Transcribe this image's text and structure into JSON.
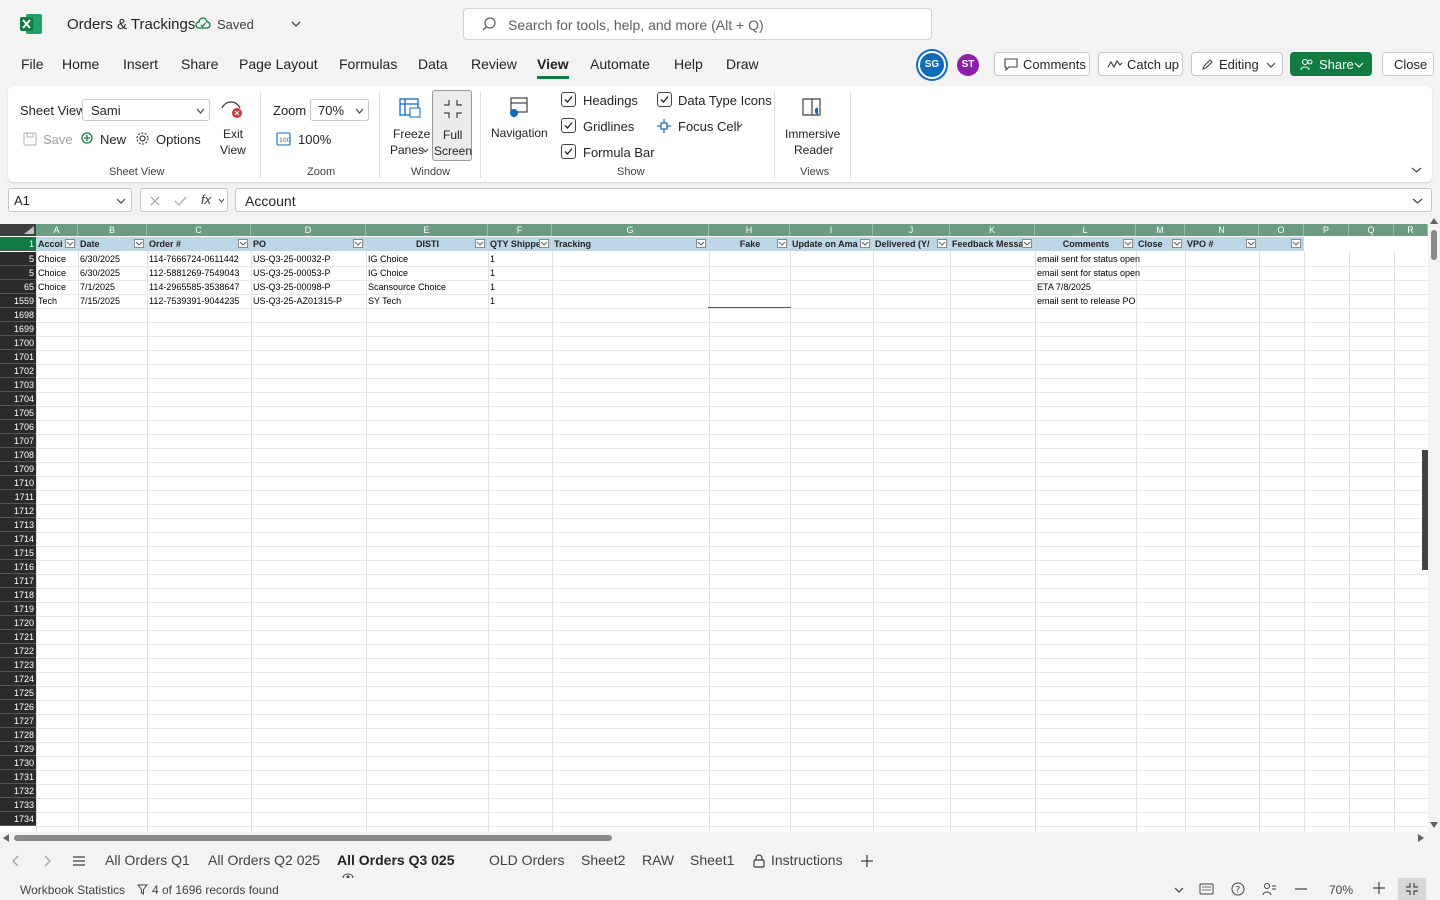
{
  "app": {
    "title": "Orders & Trackings",
    "saved_status": "Saved",
    "search_placeholder": "Search for tools, help, and more (Alt + Q)"
  },
  "menu": {
    "items": [
      "File",
      "Home",
      "Insert",
      "Share",
      "Page Layout",
      "Formulas",
      "Data",
      "Review",
      "View",
      "Automate",
      "Help",
      "Draw"
    ],
    "active": "View"
  },
  "header_right": {
    "avatar1": "SG",
    "avatar2": "ST",
    "comments": "Comments",
    "catch_up": "Catch up",
    "editing": "Editing",
    "share": "Share",
    "close": "Close"
  },
  "ribbon": {
    "sheet_view_label": "Sheet View",
    "sheet_view_value": "Sami",
    "save": "Save",
    "new": "New",
    "options": "Options",
    "exit_view_line1": "Exit",
    "exit_view_line2": "View",
    "group_sheet_view": "Sheet View",
    "zoom_label": "Zoom",
    "zoom_value": "70%",
    "zoom_100": "100%",
    "group_zoom": "Zoom",
    "freeze_line1": "Freeze",
    "freeze_line2": "Panes",
    "full_line1": "Full",
    "full_line2": "Screen",
    "group_window": "Window",
    "navigation": "Navigation",
    "headings": "Headings",
    "gridlines": "Gridlines",
    "formula_bar": "Formula Bar",
    "data_type_icons": "Data Type Icons",
    "focus_cell": "Focus Cell",
    "group_show": "Show",
    "immersive_line1": "Immersive",
    "immersive_line2": "Reader",
    "group_views": "Views"
  },
  "formula_bar": {
    "name_box": "A1",
    "content": "Account"
  },
  "grid": {
    "columns": [
      "A",
      "B",
      "C",
      "D",
      "E",
      "F",
      "G",
      "H",
      "I",
      "J",
      "K",
      "L",
      "M",
      "N",
      "O",
      "P",
      "Q",
      "R"
    ],
    "header_row": [
      "Accoi",
      "Date",
      "Order #",
      "PO",
      "DISTI",
      "QTY Shippe",
      "Tracking",
      "Fake",
      "Update on Ama",
      "Delivered (Y/",
      "Feedback Messa",
      "Comments",
      "Close",
      "VPO #",
      ""
    ],
    "header_row_number": "1",
    "rows": [
      {
        "num": "5",
        "cells": [
          "Choice",
          "6/30/2025",
          "114-7666724-0611442",
          "US-Q3-25-00032-P",
          "IG Choice",
          "1",
          "",
          "",
          "",
          "",
          "",
          "email sent for status open",
          "",
          "",
          ""
        ]
      },
      {
        "num": "5",
        "cells": [
          "Choice",
          "6/30/2025",
          "112-5881269-7549043",
          "US-Q3-25-00053-P",
          "IG Choice",
          "1",
          "",
          "",
          "",
          "",
          "",
          "email sent for status open",
          "",
          "",
          ""
        ]
      },
      {
        "num": "65",
        "cells": [
          "Choice",
          "7/1/2025",
          "114-2965585-3538647",
          "US-Q3-25-00098-P",
          "Scansource Choice",
          "1",
          "",
          "",
          "",
          "",
          "",
          "ETA 7/8/2025",
          "",
          "",
          ""
        ]
      },
      {
        "num": "1559",
        "cells": [
          "Tech",
          "7/15/2025",
          "112-7539391-9044235",
          "US-Q3-25-AZ01315-P",
          "SY Tech",
          "1",
          "",
          "",
          "",
          "",
          "",
          "email sent to release PO",
          "",
          "",
          ""
        ]
      }
    ],
    "empty_row_numbers": [
      "1698",
      "1699",
      "1700",
      "1701",
      "1702",
      "1703",
      "1704",
      "1705",
      "1706",
      "1707",
      "1708",
      "1709",
      "1710",
      "1711",
      "1712",
      "1713",
      "1714",
      "1715",
      "1716",
      "1717",
      "1718",
      "1719",
      "1720",
      "1721",
      "1722",
      "1723",
      "1724",
      "1725",
      "1726",
      "1727",
      "1728",
      "1729",
      "1730",
      "1731",
      "1732",
      "1733",
      "1734"
    ]
  },
  "sheet_tabs": {
    "items": [
      "All Orders Q1",
      "All Orders Q2 025",
      "All Orders Q3 025",
      "OLD Orders",
      "Sheet2",
      "RAW",
      "Sheet1",
      "Instructions"
    ],
    "active": "All Orders Q3 025"
  },
  "status_bar": {
    "workbook_statistics": "Workbook Statistics",
    "records": "4 of 1696 records found",
    "zoom": "70%"
  },
  "colors": {
    "accent": "#107c41",
    "column_header_bg": "#6b9b80",
    "table_header_bg": "#bcd6e5"
  }
}
